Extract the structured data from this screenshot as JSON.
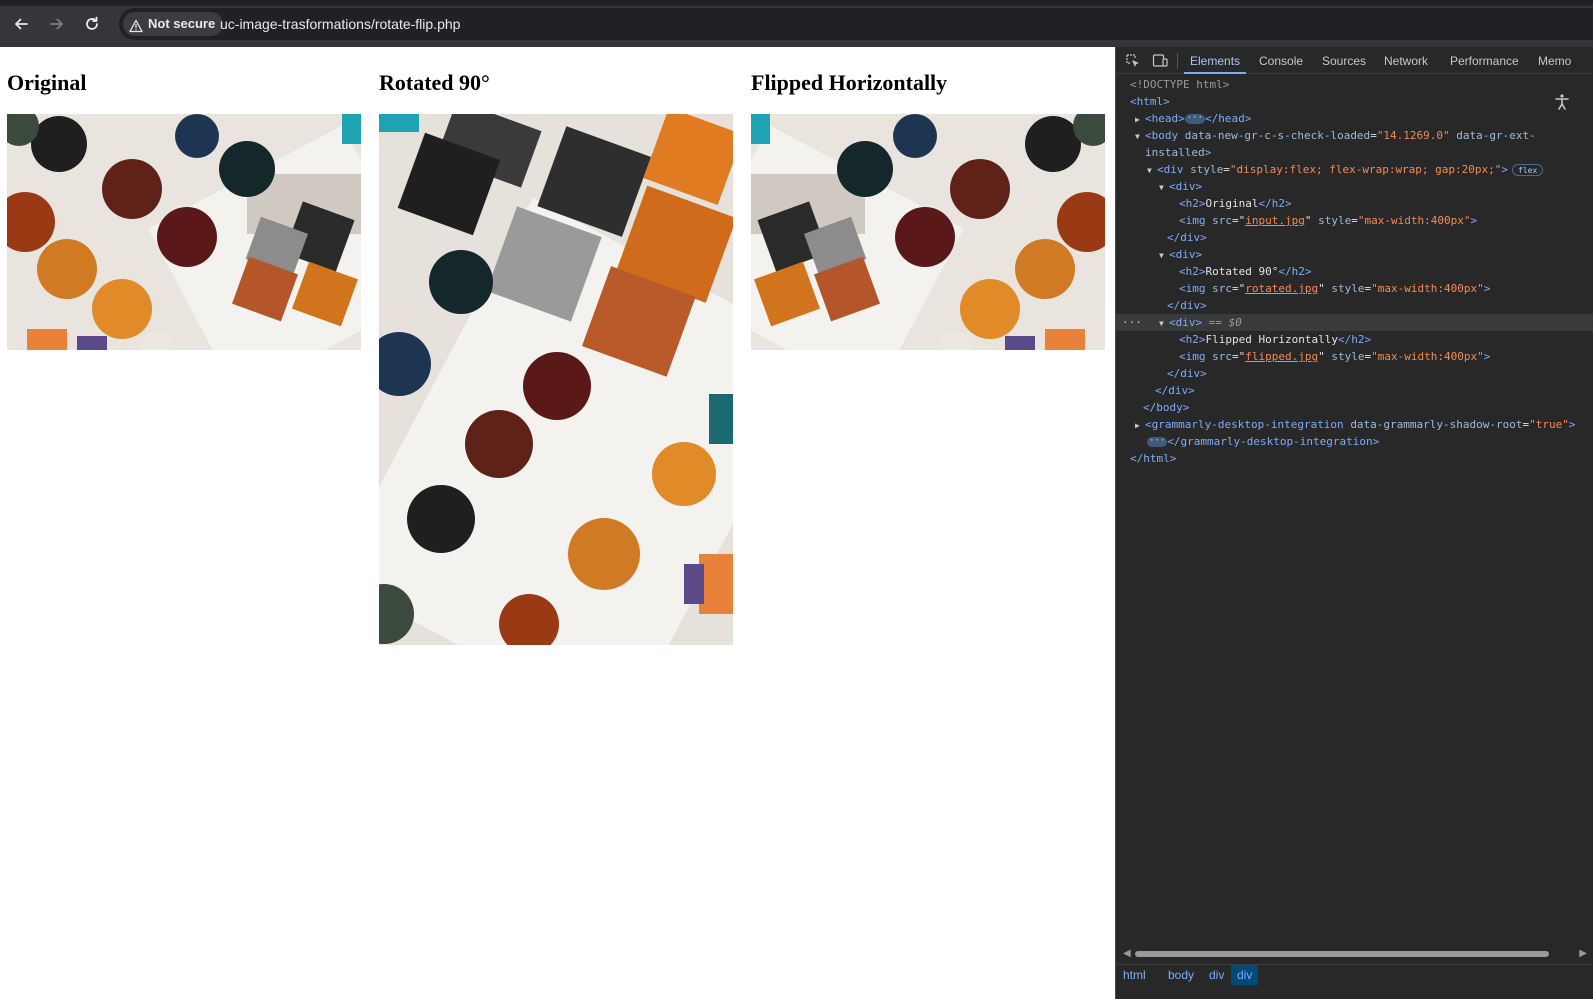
{
  "browser": {
    "security_label": "Not secure",
    "url": "uc-image-trasformations/rotate-flip.php",
    "icons": [
      "back-arrow-icon",
      "forward-arrow-icon",
      "reload-icon",
      "warning-icon"
    ]
  },
  "page": {
    "sections": [
      {
        "heading": "Original",
        "image_name": "input.jpg"
      },
      {
        "heading": "Rotated 90°",
        "image_name": "rotated.jpg"
      },
      {
        "heading": "Flipped Horizontally",
        "image_name": "flipped.jpg"
      }
    ]
  },
  "devtools": {
    "tabs": [
      "Elements",
      "Console",
      "Sources",
      "Network",
      "Performance",
      "Memo"
    ],
    "active_tab": "Elements",
    "dom": {
      "doctype": "<!DOCTYPE html>",
      "html_open": "<html>",
      "head_open": "<head>",
      "head_close": "</head>",
      "body_tag": "body",
      "body_attr1": "data-new-gr-c-s-check-loaded",
      "body_attr1_val": "\"14.1269.0\"",
      "body_attr2": "data-gr-ext-",
      "body_attr2_cont": "installed",
      "div_tag": "div",
      "style_attr": "style",
      "flex_style_val": "\"display:flex; flex-wrap:wrap; gap:20px;\"",
      "flex_badge": "flex",
      "div_open": "<div>",
      "div_close": "</div>",
      "h2_open": "<h2>",
      "h2_close": "</h2>",
      "img_tag": "<img",
      "src_attr": "src",
      "img_style_val": "\"max-width:400px\"",
      "selected_marker": "== $0",
      "body_close": "</body>",
      "grammarly_tag": "grammarly-desktop-integration",
      "grammarly_attr": "data-grammarly-shadow-root",
      "grammarly_attr_val": "\"true\"",
      "grammarly_close": "</grammarly-desktop-integration>",
      "html_close": "</html>"
    },
    "breadcrumbs": [
      "html",
      "body",
      "div",
      "div"
    ],
    "active_breadcrumb": "div"
  }
}
